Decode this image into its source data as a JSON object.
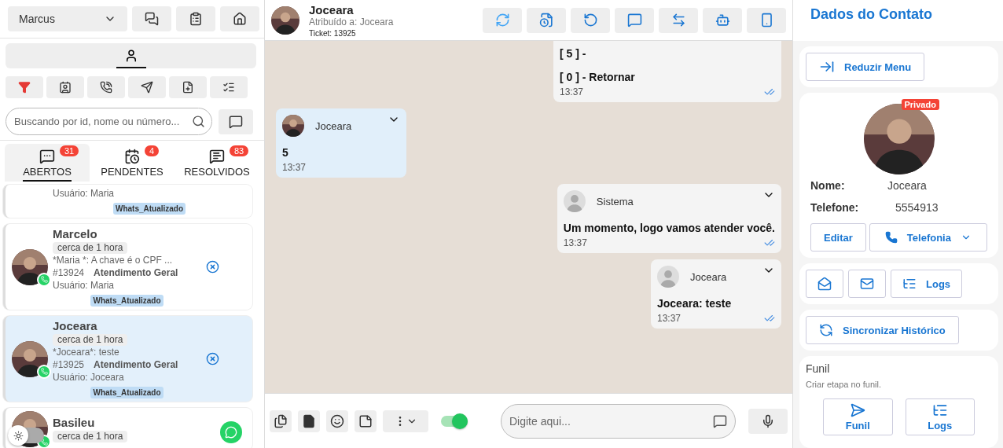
{
  "sidebar": {
    "user_select": "Marcus",
    "profile_tab": {
      "selected": true
    },
    "search": {
      "placeholder": "Buscando por id, nome ou número..."
    },
    "tabs": [
      {
        "label": "ABERTOS",
        "badge": "31",
        "selected": true
      },
      {
        "label": "PENDENTES",
        "badge": "4",
        "selected": false
      },
      {
        "label": "RESOLVIDOS",
        "badge": "83",
        "selected": false
      }
    ],
    "tickets": [
      {
        "user": "Usuário: Maria",
        "tag": "Whats_Atualizado",
        "selected": false
      },
      {
        "name": "Marcelo",
        "time": "cerca de 1 hora",
        "preview": "*Maria *: A chave é o CPF ...",
        "number": "#13924",
        "queue": "Atendimento Geral",
        "user": "Usuário: Maria",
        "tag": "Whats_Atualizado",
        "selected": false
      },
      {
        "name": "Joceara",
        "time": "cerca de 1 hora",
        "preview": "*Joceara*: teste",
        "number": "#13925",
        "queue": "Atendimento Geral",
        "user": "Usuário: Joceara",
        "tag": "Whats_Atualizado",
        "selected": true
      },
      {
        "name": "Basileu",
        "time": "cerca de 1 hora",
        "selected": false
      }
    ],
    "theme_toggle": {
      "on": false
    }
  },
  "chat": {
    "header": {
      "name": "Joceara",
      "assigned": "Atribuído a: Joceara",
      "ticket": "Ticket: 13925"
    },
    "messages": [
      {
        "kind": "outgoing",
        "paragraphs": [
          "[ 5 ] -",
          "[ 0 ] - Retornar"
        ],
        "time": "13:37",
        "read": true
      },
      {
        "kind": "incoming",
        "sender": "Joceara",
        "paragraphs": [
          "5"
        ],
        "time": "13:37",
        "read": false
      },
      {
        "kind": "outgoing",
        "sender": "Sistema",
        "paragraphs": [
          "Um momento, logo vamos atender você."
        ],
        "time": "13:37",
        "read": true
      },
      {
        "kind": "outgoing",
        "sender": "Joceara",
        "paragraphs": [
          "Joceara: teste"
        ],
        "time": "13:37",
        "read": true
      }
    ],
    "composer": {
      "placeholder": "Digite aqui...",
      "signature_on": true
    }
  },
  "contact_panel": {
    "title": "Dados do Contato",
    "collapse_button": "Reduzir Menu",
    "badge": "Privado",
    "fields": [
      {
        "label": "Nome:",
        "value": "Joceara"
      },
      {
        "label": "Telefone:",
        "value": "5554913"
      }
    ],
    "edit_button": "Editar",
    "phone_button": "Telefonia",
    "logs_button": "Logs",
    "sync_button": "Sincronizar Histórico",
    "funnel": {
      "title": "Funil",
      "subtitle": "Criar etapa no funil.",
      "buttons": [
        "Funil",
        "Logs"
      ]
    }
  }
}
